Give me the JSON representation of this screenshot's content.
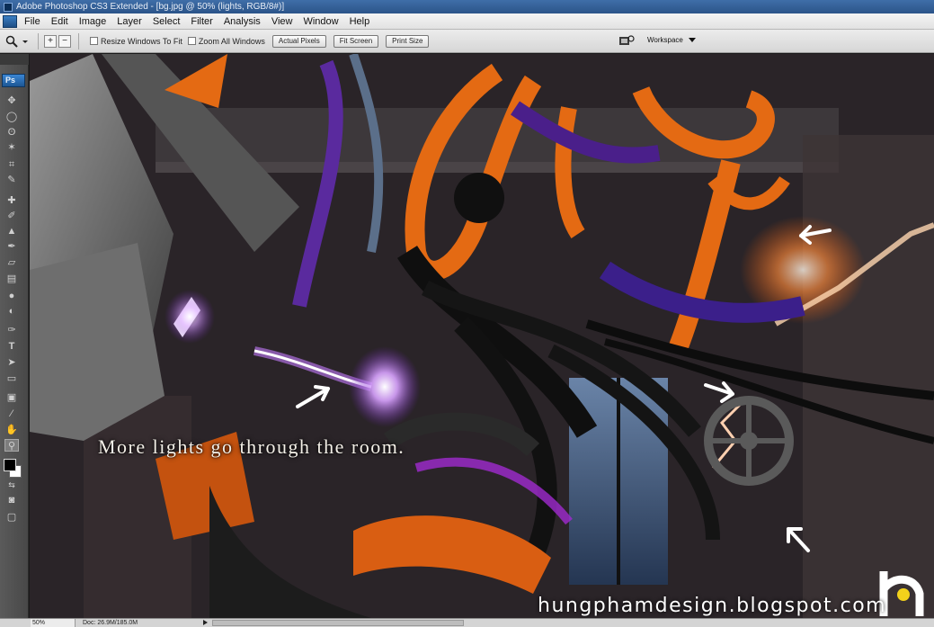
{
  "window": {
    "title": "Adobe Photoshop CS3 Extended - [bg.jpg @ 50% (lights, RGB/8#)]"
  },
  "menubar": {
    "items": [
      "File",
      "Edit",
      "Image",
      "Layer",
      "Select",
      "Filter",
      "Analysis",
      "View",
      "Window",
      "Help"
    ]
  },
  "options": {
    "resize_windows_label": "Resize Windows To Fit",
    "zoom_all_windows_label": "Zoom All Windows",
    "actual_pixels_label": "Actual Pixels",
    "fit_screen_label": "Fit Screen",
    "print_size_label": "Print Size",
    "workspace_label": "Workspace"
  },
  "toolbox": {
    "badge": "Ps",
    "type_tool_glyph": "T"
  },
  "canvas": {
    "caption": "More lights go through the room.",
    "watermark": "hungphamdesign.blogspot.com",
    "colors": {
      "orange": "#e46a13",
      "purple": "#5a2a9e",
      "glow": "#c77dff",
      "dark": "#141214"
    }
  },
  "status": {
    "zoom": "50%",
    "doc": "Doc: 26.9M/185.0M"
  }
}
